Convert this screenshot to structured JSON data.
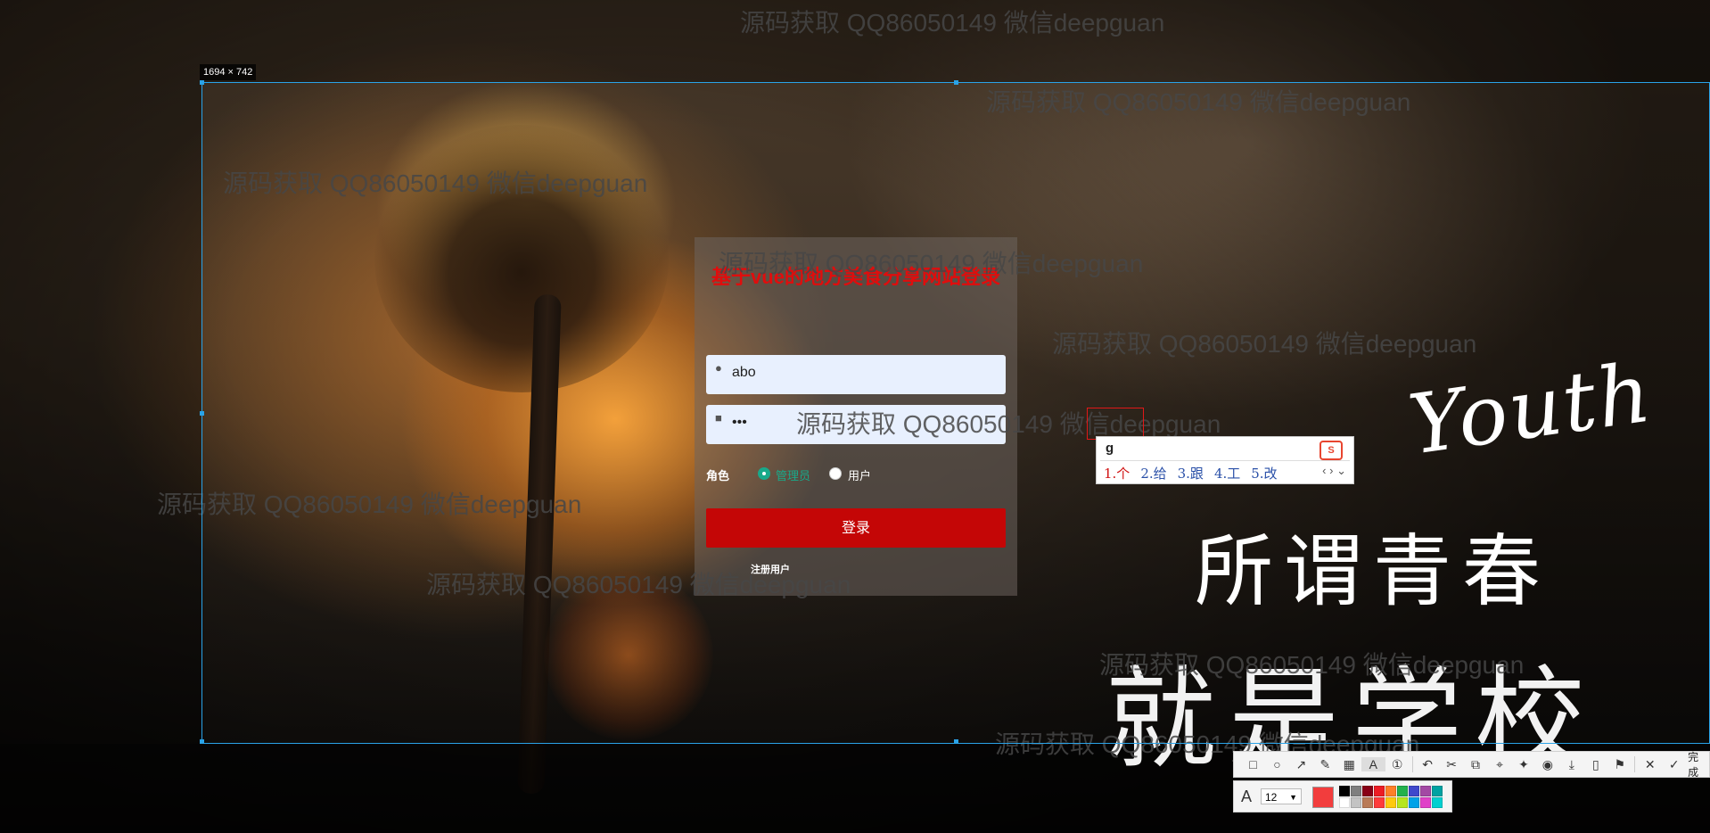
{
  "capture": {
    "size_label": "1694 × 742"
  },
  "login": {
    "title": "基于vue的地方美食分享网站登录",
    "username_value": "abo",
    "password_value": "•••",
    "role_label": "角色",
    "role_options": [
      "管理员",
      "用户"
    ],
    "selected_role": "管理员",
    "login_button": "登录",
    "register_link": "注册用户"
  },
  "slogans": {
    "youth": "Youth",
    "line1": "所谓青春",
    "line2": "就是学校"
  },
  "watermark": "源码获取 QQ86050149 微信deepguan",
  "ime": {
    "input": "g",
    "candidates": [
      "1.个",
      "2.给",
      "3.跟",
      "4.工",
      "5.改"
    ],
    "logo": "S"
  },
  "toolbar": {
    "icons": [
      "rectangle-icon",
      "circle-icon",
      "arrow-icon",
      "pen-icon",
      "mosaic-icon",
      "text-icon",
      "number-icon",
      "undo-icon",
      "cutout-icon",
      "copy-icon",
      "crop-icon",
      "pin-icon",
      "record-icon",
      "download-icon",
      "phone-icon",
      "bookmark-icon",
      "close-icon"
    ],
    "done_label": "完成",
    "font_size": "12",
    "current_color": "#f23d3d",
    "palette": [
      "#000000",
      "#7f7f7f",
      "#880015",
      "#ed1c24",
      "#ff7f27",
      "#22b14c",
      "#3f48cc",
      "#a349a4",
      "#00a2a2",
      "#ffffff",
      "#c3c3c3",
      "#b97a57",
      "#ff3b3b",
      "#ffc90e",
      "#b5e61d",
      "#00a2e8",
      "#e040c8",
      "#00d0d0"
    ]
  }
}
